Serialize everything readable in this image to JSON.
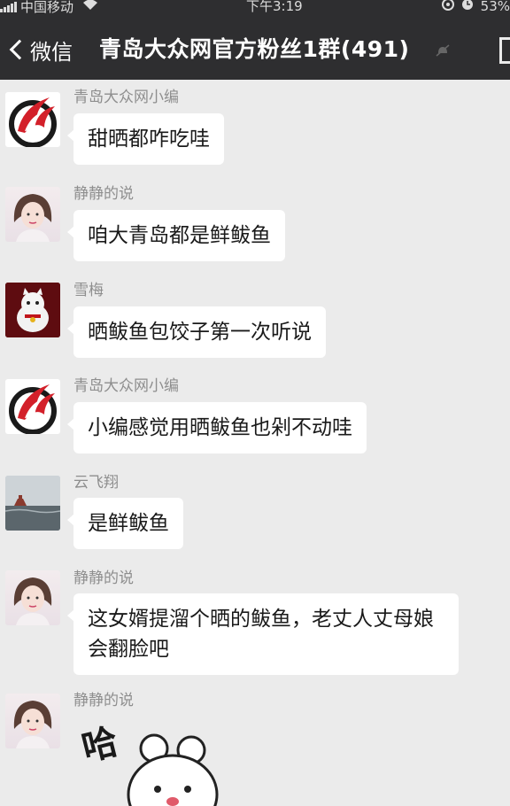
{
  "status_bar": {
    "carrier": "中国移动",
    "time": "下午3:19",
    "battery": "53%"
  },
  "nav": {
    "back_label": "微信",
    "title": "青岛大众网官方粉丝1群(491)"
  },
  "messages": [
    {
      "sender": "青岛大众网小编",
      "avatar": "red-flame-logo",
      "text": "甜晒都咋吃哇"
    },
    {
      "sender": "静静的说",
      "avatar": "girl-portrait",
      "text": "咱大青岛都是鲜鲅鱼"
    },
    {
      "sender": "雪梅",
      "avatar": "lucky-cat",
      "text": "晒鲅鱼包饺子第一次听说"
    },
    {
      "sender": "青岛大众网小编",
      "avatar": "red-flame-logo",
      "text": "小编感觉用晒鲅鱼也剁不动哇"
    },
    {
      "sender": "云飞翔",
      "avatar": "seaside-pavilion",
      "text": "是鲜鲅鱼"
    },
    {
      "sender": "静静的说",
      "avatar": "girl-portrait",
      "text": "这女婿提溜个晒的鲅鱼，老丈人丈母娘会翻脸吧"
    },
    {
      "sender": "静静的说",
      "avatar": "girl-portrait",
      "sticker_text": "哈"
    }
  ],
  "colors": {
    "nav_bg": "#2e2e30",
    "chat_bg": "#ebebeb",
    "bubble_bg": "#ffffff",
    "logo_red": "#d3202a"
  }
}
